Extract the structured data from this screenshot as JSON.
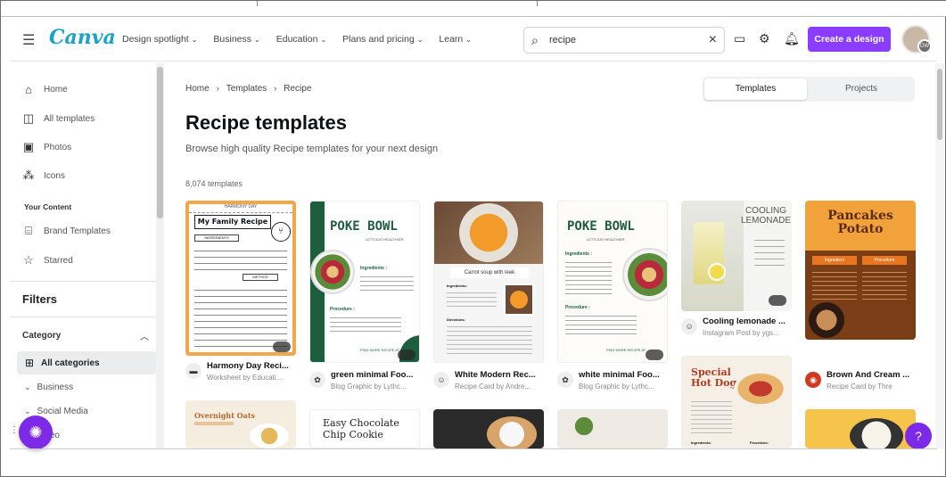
{
  "header": {
    "logo": "Canva",
    "nav": [
      "Design spotlight",
      "Business",
      "Education",
      "Plans and pricing",
      "Learn"
    ],
    "search_value": "recipe",
    "create_label": "Create a design",
    "avatar_badge": "DW"
  },
  "sidebar": {
    "items": [
      "Home",
      "All templates",
      "Photos",
      "Icons"
    ],
    "your_content_label": "Your Content",
    "content_items": [
      "Brand Templates",
      "Starred"
    ],
    "filters_label": "Filters",
    "category_label": "Category",
    "all_categories": "All categories",
    "subcategories": [
      "Business",
      "Social Media",
      "Video"
    ]
  },
  "main": {
    "breadcrumb": [
      "Home",
      "Templates",
      "Recipe"
    ],
    "tabs": [
      "Templates",
      "Projects"
    ],
    "title": "Recipe templates",
    "subtitle": "Browse high quality Recipe templates for your next design",
    "count": "8,074 templates",
    "cards": [
      {
        "title": "Harmony Day Reci...",
        "sub": "Worksheet by Educati...",
        "heading": "My Family Recipe",
        "tag": "HARMONY DAY",
        "label1": "INGREDIENTS",
        "label2": "METHOD"
      },
      {
        "title": "green minimal Foo...",
        "sub": "Blog Graphic by Lythc...",
        "heading": "POKE BOWL",
        "tag": "LET'S EAT HEALTHIER",
        "label1": "Ingredients :",
        "label2": "Procedure :",
        "footer": "FIND MORE RECIPE AT"
      },
      {
        "title": "White Modern Rec...",
        "sub": "Recipe Card by Andre...",
        "heading": "Carrot soup with leek",
        "label1": "Ingredients:",
        "label2": "Directions:"
      },
      {
        "title": "white minimal Foo...",
        "sub": "Blog Graphic by Lythc...",
        "heading": "POKE BOWL",
        "tag": "LET'S EAT HEALTHIER",
        "label1": "Ingredients :",
        "label2": "Procedure :",
        "footer": "FIND MORE RECIPE AT"
      },
      {
        "title": "Cooling lemonade ...",
        "sub": "Instagram Post by ygs...",
        "heading": "COOLING LEMONADE"
      },
      {
        "title": "Brown And Cream ...",
        "sub": "Recipe Card by Thre",
        "heading": "Pancakes Potato",
        "label1": "Ingredient",
        "label2": "Procedure"
      },
      {
        "heading": "Special Hot Dog",
        "label1": "Ingredients:",
        "label2": "Procedure:"
      },
      {
        "heading": "Overnight Oats"
      },
      {
        "heading": "Easy Chocolate Chip Cookie"
      }
    ]
  },
  "colors": {
    "brand": "#8b3dff",
    "logo": "#19a3c9"
  }
}
